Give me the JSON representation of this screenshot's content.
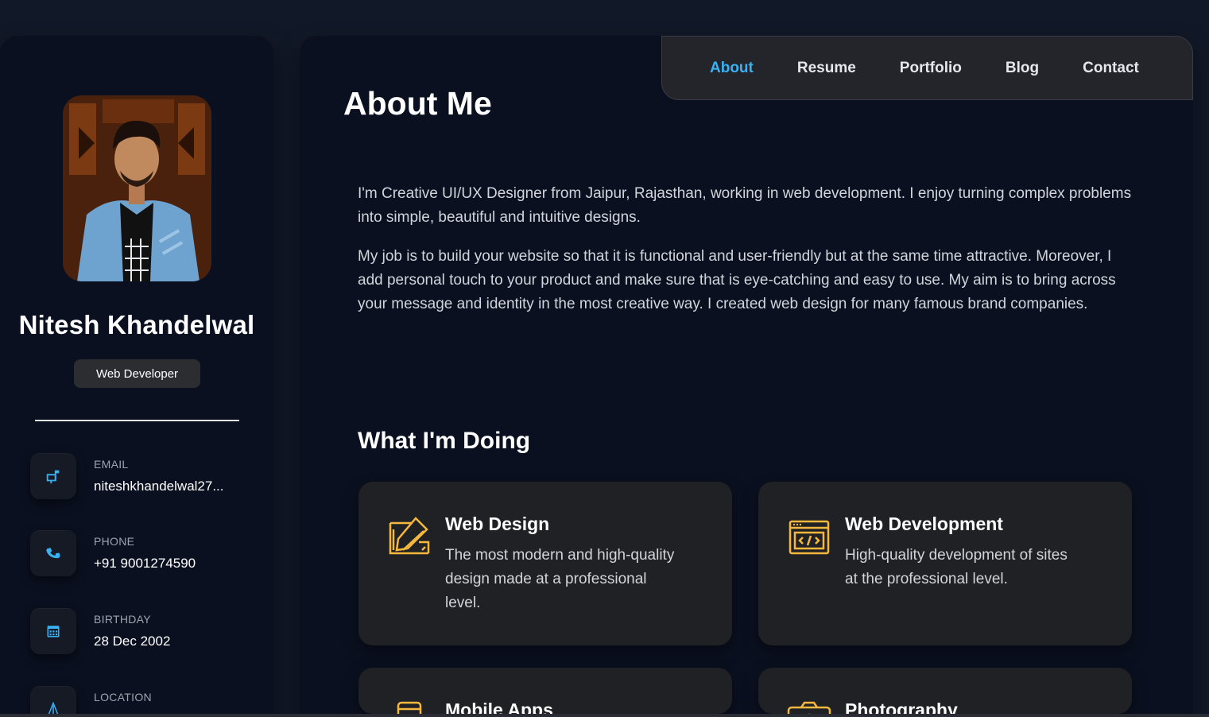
{
  "profile": {
    "name": "Nitesh Khandelwal",
    "role": "Web Developer",
    "contacts": [
      {
        "label": "EMAIL",
        "value": "niteshkhandelwal27..."
      },
      {
        "label": "PHONE",
        "value": "+91 9001274590"
      },
      {
        "label": "BIRTHDAY",
        "value": "28 Dec 2002"
      },
      {
        "label": "LOCATION",
        "value": ""
      }
    ]
  },
  "nav": {
    "items": [
      "About",
      "Resume",
      "Portfolio",
      "Blog",
      "Contact"
    ],
    "active": "About"
  },
  "about": {
    "title": "About Me",
    "paragraphs": [
      "I'm Creative UI/UX Designer from Jaipur, Rajasthan, working in web development. I enjoy turning complex problems into simple, beautiful and intuitive designs.",
      "My job is to build your website so that it is functional and user-friendly but at the same time attractive. Moreover, I add personal touch to your product and make sure that is eye-catching and easy to use. My aim is to bring across your message and identity in the most creative way. I created web design for many famous brand companies."
    ]
  },
  "services": {
    "title": "What I'm Doing",
    "items": [
      {
        "title": "Web Design",
        "desc": "The most modern and high-quality design made at a professional level.",
        "icon": "design-icon"
      },
      {
        "title": "Web Development",
        "desc": "High-quality development of sites at the professional level.",
        "icon": "code-icon"
      },
      {
        "title": "Mobile Apps",
        "desc": "",
        "icon": "mobile-icon"
      },
      {
        "title": "Photography",
        "desc": "",
        "icon": "camera-icon"
      }
    ]
  },
  "colors": {
    "accent": "#38b2f4",
    "service_icon": "#f5b83d",
    "background": "#0b1020",
    "card": "#202124"
  }
}
